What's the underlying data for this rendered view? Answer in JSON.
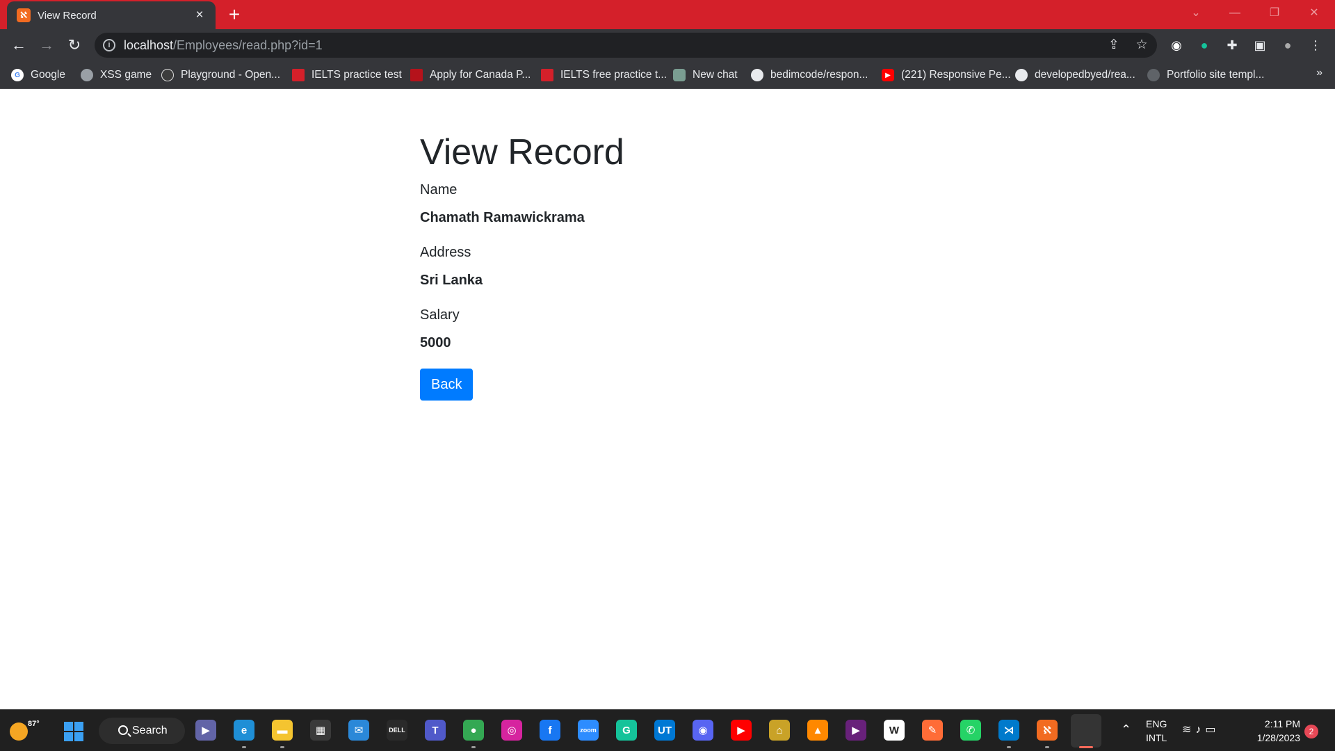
{
  "browser": {
    "tab_title": "View Record",
    "tab_favicon": "xampp-icon",
    "url_host": "localhost",
    "url_path": "/Employees/read.php?id=1",
    "bookmarks": [
      {
        "label": "Google",
        "icon": "google-icon",
        "color": "#ffffff"
      },
      {
        "label": "XSS game",
        "icon": "globe-icon",
        "color": "#9aa0a6"
      },
      {
        "label": "Playground - Open...",
        "icon": "openai-icon",
        "color": "#3c3c3c"
      },
      {
        "label": "IELTS practice test",
        "icon": "ielts-icon",
        "color": "#d4202a"
      },
      {
        "label": "Apply for Canada P...",
        "icon": "canada-icon",
        "color": "#b5121b"
      },
      {
        "label": "IELTS free practice t...",
        "icon": "ielts-icon",
        "color": "#d4202a"
      },
      {
        "label": "New chat",
        "icon": "chatgpt-icon",
        "color": "#7a9e92"
      },
      {
        "label": "bedimcode/respon...",
        "icon": "github-icon",
        "color": "#e8eaed"
      },
      {
        "label": "(221) Responsive Pe...",
        "icon": "youtube-icon",
        "color": "#ff0000"
      },
      {
        "label": "developedbyed/rea...",
        "icon": "github-icon",
        "color": "#e8eaed"
      },
      {
        "label": "Portfolio site templ...",
        "icon": "globe-icon",
        "color": "#5f6368"
      }
    ],
    "bookmarks_overflow": "»"
  },
  "page": {
    "title": "View Record",
    "fields": [
      {
        "label": "Name",
        "value": "Chamath Ramawickrama"
      },
      {
        "label": "Address",
        "value": "Sri Lanka"
      },
      {
        "label": "Salary",
        "value": "5000"
      }
    ],
    "back_button": "Back",
    "button_color": "#007bff"
  },
  "taskbar": {
    "temperature": "87°",
    "search_label": "Search",
    "language_line1": "ENG",
    "language_line2": "INTL",
    "time": "2:11 PM",
    "date": "1/28/2023",
    "notification_count": "2",
    "apps": [
      {
        "name": "meet-icon",
        "color": "#6264a7",
        "glyph": "▶"
      },
      {
        "name": "edge-icon",
        "color": "#1f8fd6",
        "glyph": "e"
      },
      {
        "name": "file-explorer-icon",
        "color": "#f4c430",
        "glyph": "▬"
      },
      {
        "name": "microsoft-store-icon",
        "color": "#3a3a3a",
        "glyph": "▦"
      },
      {
        "name": "mail-icon",
        "color": "#2b88d8",
        "glyph": "✉"
      },
      {
        "name": "dell-icon",
        "color": "#2a2a2a",
        "glyph": "DELL"
      },
      {
        "name": "teams-icon",
        "color": "#5059c9",
        "glyph": "T"
      },
      {
        "name": "chrome-icon",
        "color": "#34a853",
        "glyph": "●"
      },
      {
        "name": "instagram-icon",
        "color": "#d6249f",
        "glyph": "◎"
      },
      {
        "name": "facebook-icon",
        "color": "#1877f2",
        "glyph": "f"
      },
      {
        "name": "zoom-icon",
        "color": "#2d8cff",
        "glyph": "zoom"
      },
      {
        "name": "grammarly-icon",
        "color": "#15c39a",
        "glyph": "G"
      },
      {
        "name": "ut-icon",
        "color": "#0078d4",
        "glyph": "UT"
      },
      {
        "name": "discord-icon",
        "color": "#5865f2",
        "glyph": "◉"
      },
      {
        "name": "youtube-icon",
        "color": "#ff0000",
        "glyph": "▶"
      },
      {
        "name": "vpn-icon",
        "color": "#c9a227",
        "glyph": "⌂"
      },
      {
        "name": "vlc-icon",
        "color": "#ff8800",
        "glyph": "▲"
      },
      {
        "name": "visual-studio-icon",
        "color": "#68217a",
        "glyph": "▶"
      },
      {
        "name": "wikipedia-icon",
        "color": "#ffffff",
        "glyph": "W"
      },
      {
        "name": "postman-icon",
        "color": "#ff6c37",
        "glyph": "✎"
      },
      {
        "name": "whatsapp-icon",
        "color": "#25d366",
        "glyph": "✆"
      },
      {
        "name": "vscode-icon",
        "color": "#007acc",
        "glyph": "⋊"
      },
      {
        "name": "xampp-icon",
        "color": "#f26b21",
        "glyph": "ℵ"
      },
      {
        "name": "snipping-tool-icon",
        "color": "#e04a4a",
        "glyph": "✂"
      }
    ]
  }
}
